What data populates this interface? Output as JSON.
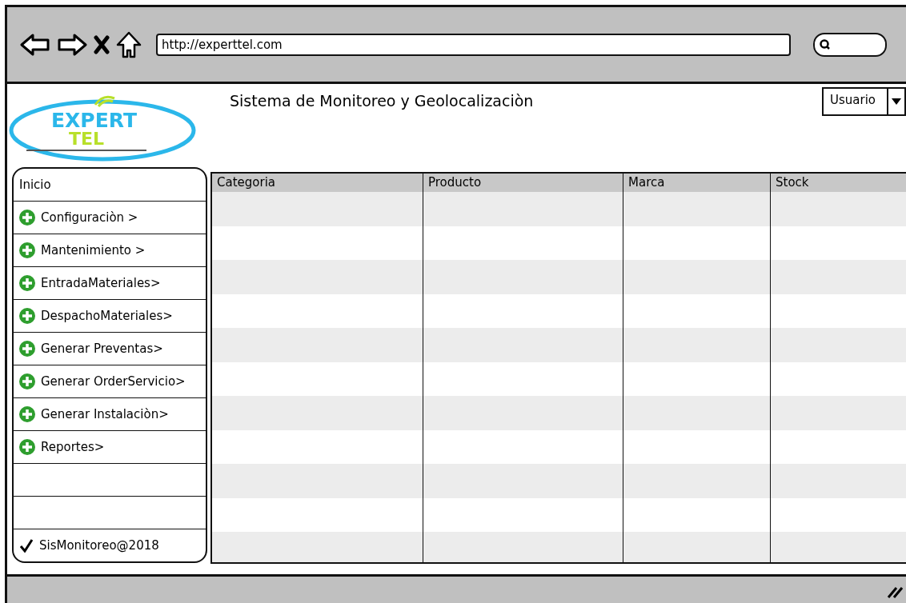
{
  "browser": {
    "url": "http://experttel.com"
  },
  "logo": {
    "line_1": "EXPERT",
    "line_2": "TEL"
  },
  "header": {
    "title": "Sistema de Monitoreo y Geolocalizaciòn",
    "user_menu": "Usuario"
  },
  "sidebar": {
    "items": [
      {
        "kind": "plain",
        "label": "Inicio"
      },
      {
        "kind": "plus",
        "label": "Configuraciòn >"
      },
      {
        "kind": "plus",
        "label": "Mantenimiento >"
      },
      {
        "kind": "plus",
        "label": "EntradaMateriales>"
      },
      {
        "kind": "plus",
        "label": "DespachoMateriales>"
      },
      {
        "kind": "plus",
        "label": "Generar Preventas>"
      },
      {
        "kind": "plus",
        "label": "Generar OrderServicio>"
      },
      {
        "kind": "plus",
        "label": "Generar Instalaciòn>"
      },
      {
        "kind": "plus",
        "label": "Reportes>"
      },
      {
        "kind": "blank"
      },
      {
        "kind": "blank"
      },
      {
        "kind": "check",
        "label": "SisMonitoreo@2018"
      }
    ]
  },
  "table": {
    "columns": [
      "Categoria",
      "Producto",
      "Marca",
      "Stock"
    ]
  }
}
